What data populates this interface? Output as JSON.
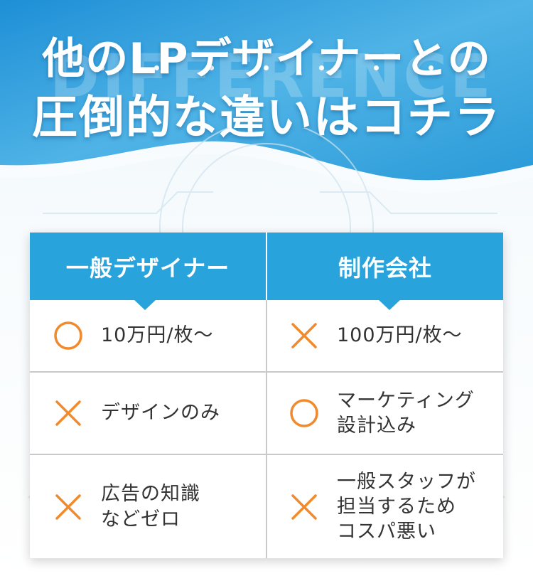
{
  "header": {
    "title_line1": "他のLPデザイナーとの",
    "title_line2": "圧倒的な違いはコチラ",
    "watermark": "DIFFERENCE"
  },
  "colors": {
    "accent_blue": "#29a3dc",
    "circle_mark": "#f08a2c",
    "cross_mark": "#f08a2c",
    "text": "#333333"
  },
  "table": {
    "columns": [
      "一般デザイナー",
      "制作会社"
    ],
    "rows": [
      {
        "left": {
          "mark": "circle-icon",
          "lines": [
            "10万円/枚〜"
          ]
        },
        "right": {
          "mark": "cross-icon",
          "lines": [
            "100万円/枚〜"
          ]
        }
      },
      {
        "left": {
          "mark": "cross-icon",
          "lines": [
            "デザインのみ"
          ]
        },
        "right": {
          "mark": "circle-icon",
          "lines": [
            "マーケティング",
            "設計込み"
          ]
        }
      },
      {
        "left": {
          "mark": "cross-icon",
          "lines": [
            "広告の知識",
            "などゼロ"
          ]
        },
        "right": {
          "mark": "cross-icon",
          "lines": [
            "一般スタッフが",
            "担当するため",
            "コスパ悪い"
          ]
        }
      }
    ]
  }
}
